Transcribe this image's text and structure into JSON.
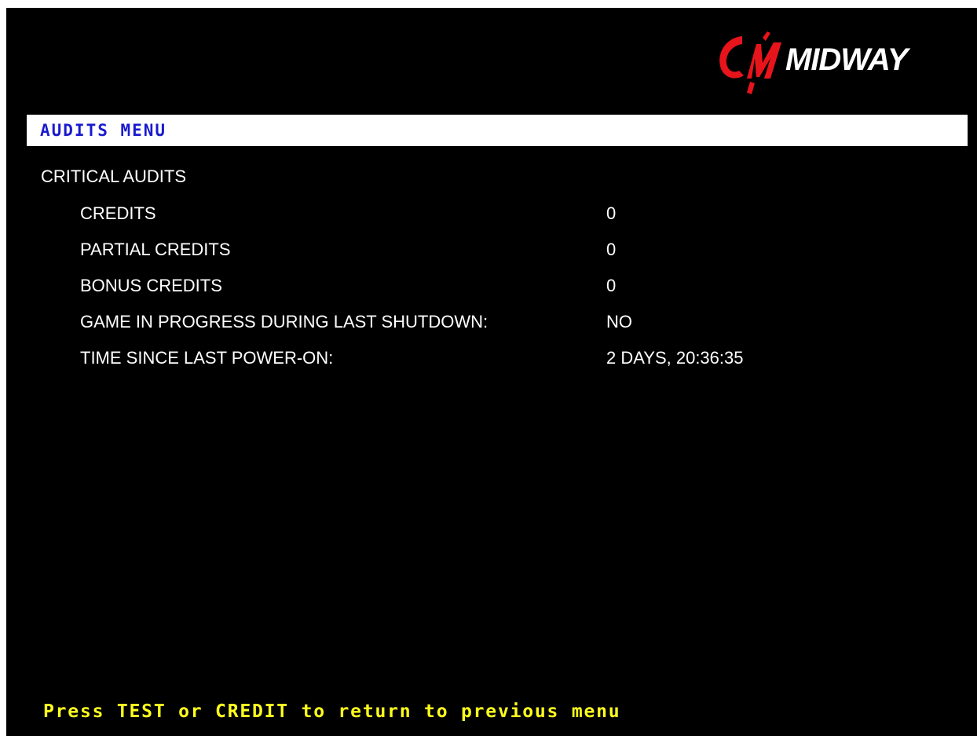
{
  "logo": {
    "text": "MIDWAY",
    "icon": "midway-emblem-icon",
    "color": "#e8141b"
  },
  "menu": {
    "title": "AUDITS MENU"
  },
  "section": {
    "heading": "CRITICAL AUDITS"
  },
  "audits": [
    {
      "label": "CREDITS",
      "value": "0"
    },
    {
      "label": "PARTIAL CREDITS",
      "value": "0"
    },
    {
      "label": "BONUS CREDITS",
      "value": "0"
    },
    {
      "label": "GAME IN PROGRESS DURING LAST SHUTDOWN:",
      "value": "NO"
    },
    {
      "label": "TIME SINCE LAST POWER-ON:",
      "value": "2 DAYS, 20:36:35"
    }
  ],
  "footer": {
    "hint": "Press TEST or CREDIT to return to previous menu"
  },
  "colors": {
    "background": "#000000",
    "title_bar": "#ffffff",
    "title_text": "#1a1acd",
    "body_text": "#ffffff",
    "hint_text": "#ffff1e"
  }
}
